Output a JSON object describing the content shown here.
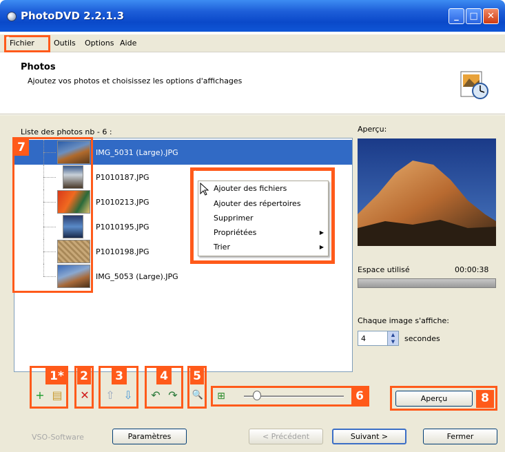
{
  "window": {
    "title": "PhotoDVD 2.2.1.3",
    "min_glyph": "_",
    "max_glyph": "□",
    "close_glyph": "✕"
  },
  "menu": {
    "star": "*",
    "items": [
      "Fichier",
      "Outils",
      "Options",
      "Aide"
    ]
  },
  "header": {
    "title": "Photos",
    "subtitle": "Ajoutez vos photos et choisissez les options d'affichages"
  },
  "list": {
    "label": "Liste des photos nb - 6 :",
    "files": [
      "IMG_5031 (Large).JPG",
      "P1010187.JPG",
      "P1010213.JPG",
      "P1010195.JPG",
      "P1010198.JPG",
      "IMG_5053 (Large).JPG"
    ],
    "selected_index": 0
  },
  "context_menu": {
    "star": "*",
    "items": [
      {
        "label": "Ajouter des fichiers",
        "submenu": false
      },
      {
        "label": "Ajouter des répertoires",
        "submenu": false
      },
      {
        "label": "Supprimer",
        "submenu": false
      },
      {
        "label": "Propriétées",
        "submenu": true
      },
      {
        "label": "Trier",
        "submenu": true
      }
    ],
    "arrow": "▶"
  },
  "preview": {
    "label": "Aperçu:",
    "space_label": "Espace utilisé",
    "space_time": "00:00:38",
    "each_image_label": "Chaque image s'affiche:",
    "seconds_value": "4",
    "seconds_label": "secondes"
  },
  "callouts": {
    "group1": "1*",
    "group2": "2",
    "group3": "3",
    "group4": "4",
    "group5": "5",
    "slider": "6",
    "list": "7",
    "preview_button": "8"
  },
  "toolbar": {
    "add_icon_glyph": "+",
    "folder_icon_glyph": "▤",
    "delete_icon_glyph": "✕",
    "move_up_glyph": "⇧",
    "move_down_glyph": "⇩",
    "rotate_left_glyph": "↶",
    "rotate_right_glyph": "↷",
    "zoom_glyph": "🔍",
    "tree_glyph": "⊞"
  },
  "buttons": {
    "apercu": "Aperçu",
    "parametres": "Paramètres",
    "precedent": "< Précédent",
    "suivant": "Suivant >",
    "fermer": "Fermer"
  },
  "footer": {
    "brand": "VSO-Software"
  },
  "colors": {
    "accent": "#ff5a1a",
    "selection": "#316ac5",
    "dialog_bg": "#ece9d8"
  }
}
